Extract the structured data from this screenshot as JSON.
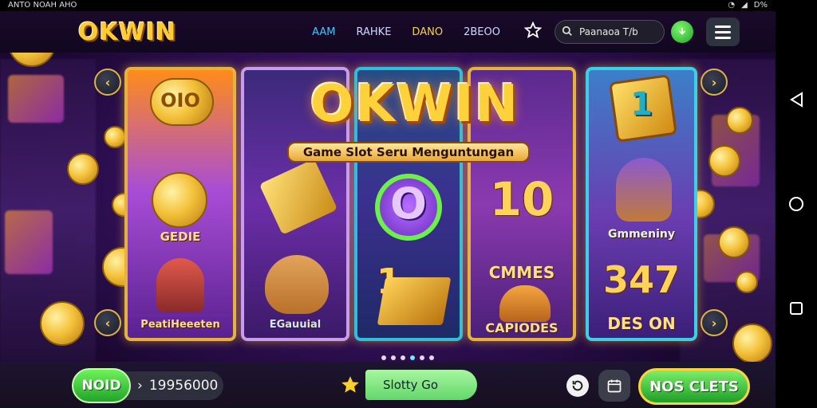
{
  "status_bar": {
    "left_text": "ANTO NOAH AHO",
    "right_text": "D%"
  },
  "header": {
    "logo": "OKWIN",
    "nav": [
      "AAM",
      "RAHKE",
      "DANO",
      "2BEOO"
    ],
    "search_value": "Paanaoa T/b"
  },
  "hero": {
    "title": "OKWIN",
    "subtitle": "Game Slot Seru Menguntungan"
  },
  "reels": {
    "r1": {
      "top_text": "OIO",
      "label_1": "GEDIE",
      "label_2": "PeatiHeeeten"
    },
    "r2": {
      "label_2": "EGauuial"
    },
    "r3": {
      "mid_text": "O",
      "low_text": "1"
    },
    "r4": {
      "top_text": "10",
      "label_1": "CMMES",
      "label_2": "CAPIODES"
    },
    "r5": {
      "top_text": "1",
      "label_1": "Gmmeniny",
      "num": "347",
      "label_2": "DES ON"
    }
  },
  "carousel": {
    "dots": 6,
    "active_index": 3
  },
  "bottom_bar": {
    "nodi_label": "NOID",
    "balance": "19956000",
    "slot_label": "Slotty Go",
    "cta_label": "NOS CLETS"
  },
  "colors": {
    "accent_gold": "#ffcc33",
    "accent_green": "#2fb33a",
    "accent_cyan": "#3cc8ff"
  },
  "icons": [
    "star-icon",
    "search-icon",
    "download-icon",
    "menu-icon",
    "chevron-left-icon",
    "chevron-right-icon",
    "refresh-icon",
    "calendar-icon",
    "back-icon",
    "home-icon",
    "recents-icon"
  ]
}
